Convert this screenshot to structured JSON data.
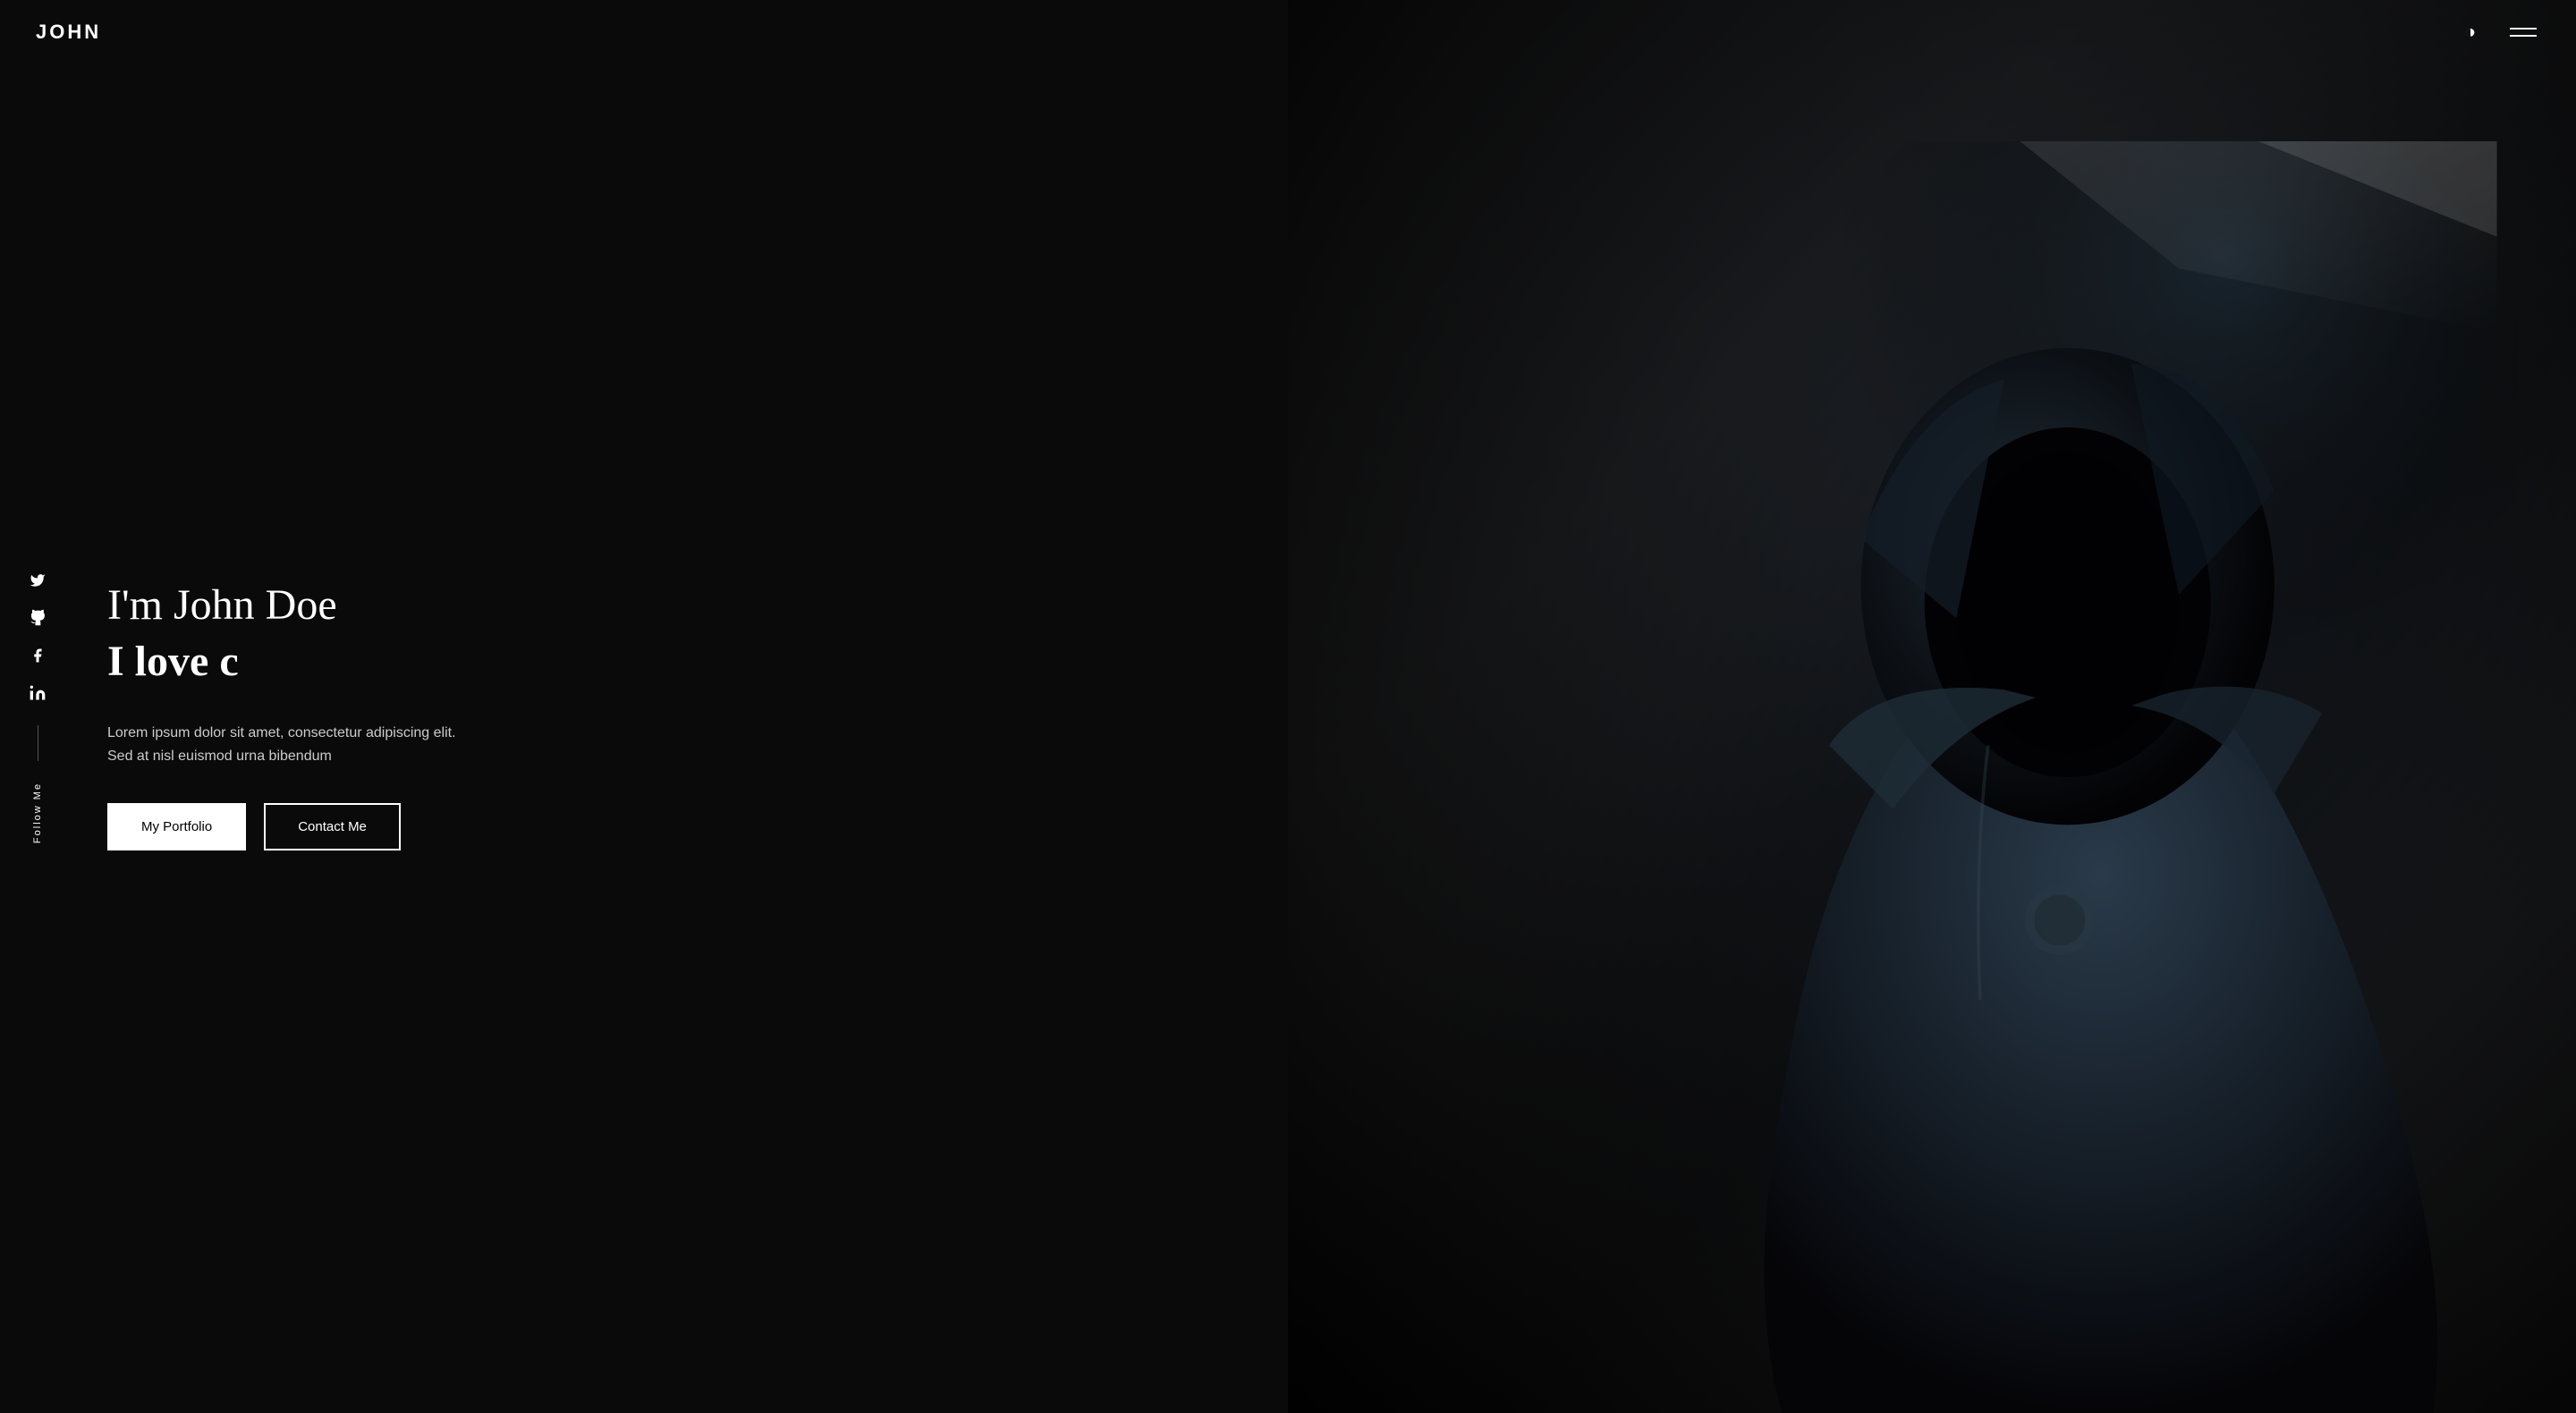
{
  "header": {
    "logo": "JOHN",
    "theme_toggle_icon": "◑",
    "hamburger_label": "menu"
  },
  "social": {
    "follow_label": "Follow Me",
    "icons": [
      {
        "name": "twitter",
        "symbol": "𝕏",
        "label": "twitter-icon"
      },
      {
        "name": "github",
        "symbol": "⊙",
        "label": "github-icon"
      },
      {
        "name": "facebook",
        "symbol": "f",
        "label": "facebook-icon"
      },
      {
        "name": "linkedin",
        "symbol": "in",
        "label": "linkedin-icon"
      }
    ]
  },
  "hero": {
    "name_line": "I'm John Doe",
    "tagline": "I love c",
    "description": "Lorem ipsum dolor sit amet, consectetur adipiscing elit. Sed at nisl euismod urna bibendum",
    "portfolio_button": "My Portfolio",
    "contact_button": "Contact Me"
  },
  "colors": {
    "background": "#0a0a0a",
    "text_primary": "#ffffff",
    "text_secondary": "#cccccc",
    "accent": "#ffffff"
  }
}
